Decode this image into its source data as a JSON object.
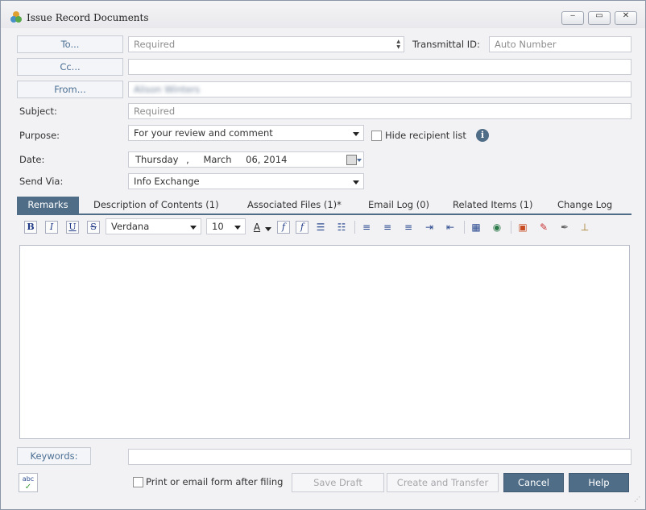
{
  "window": {
    "title": "Issue Record Documents",
    "minimize": "‒",
    "maximize": "▭",
    "close": "✕"
  },
  "header": {
    "to_label": "To...",
    "to_placeholder": "Required",
    "transmittal_label": "Transmittal ID:",
    "transmittal_value": "Auto Number",
    "cc_label": "Cc...",
    "cc_value": "",
    "from_label": "From...",
    "from_value": "Alison Winters",
    "subject_label": "Subject:",
    "subject_placeholder": "Required",
    "purpose_label": "Purpose:",
    "purpose_value": "For your review and comment",
    "hide_recipients_label": "Hide recipient list",
    "date_label": "Date:",
    "date_day": "Thursday",
    "date_sep": ",",
    "date_month": "March",
    "date_rest": "06, 2014",
    "send_via_label": "Send Via:",
    "send_via_value": "Info Exchange"
  },
  "tabs": [
    {
      "label": "Remarks"
    },
    {
      "label": "Description of Contents (1)"
    },
    {
      "label": "Associated Files (1)*"
    },
    {
      "label": "Email Log (0)"
    },
    {
      "label": "Related Items (1)"
    },
    {
      "label": "Change Log"
    }
  ],
  "toolbar": {
    "bold": "B",
    "italic": "I",
    "underline": "U",
    "strike": "S",
    "font_family": "Verdana",
    "font_size": "10",
    "font_color_glyph": "A",
    "function_glyph": "f"
  },
  "footer": {
    "keywords_label": "Keywords:",
    "keywords_value": "",
    "spellcheck_glyph": "abc",
    "print_label": "Print or email form after filing",
    "save_draft": "Save Draft",
    "create_transfer": "Create and Transfer",
    "cancel": "Cancel",
    "help": "Help"
  },
  "colors": {
    "accent": "#4f6d87",
    "link": "#4b6f93"
  }
}
